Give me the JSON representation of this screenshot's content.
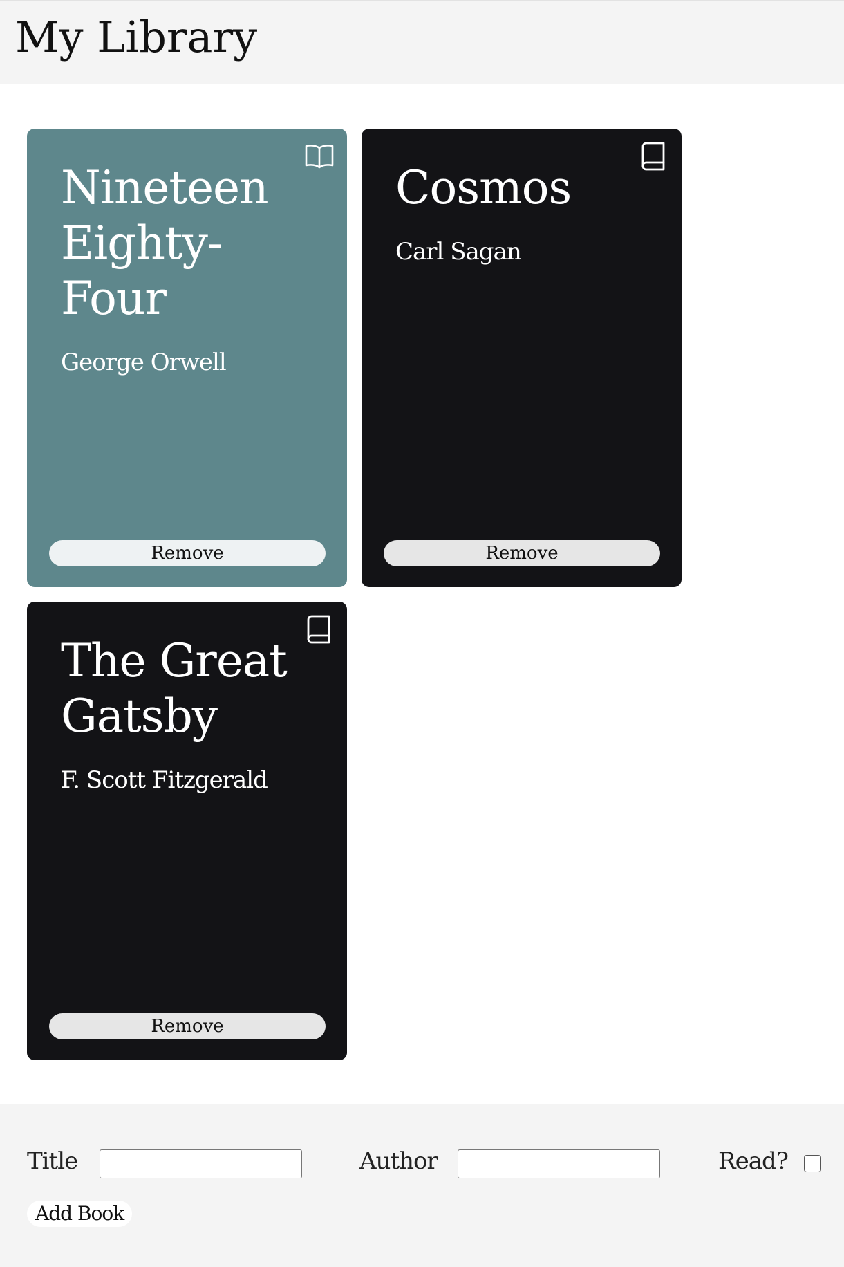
{
  "header": {
    "title": "My Library"
  },
  "books": [
    {
      "title": "Nineteen Eighty-Four",
      "title_lines": [
        "Nineteen",
        "Eighty-",
        "Four"
      ],
      "author": "George Orwell",
      "read": true,
      "status_icon": "open-book-icon",
      "remove_label": "Remove"
    },
    {
      "title": "Cosmos",
      "title_lines": [
        "Cosmos"
      ],
      "author": "Carl Sagan",
      "read": false,
      "status_icon": "closed-book-icon",
      "remove_label": "Remove"
    },
    {
      "title": "The Great Gatsby",
      "title_lines": [
        "The Great",
        "Gatsby"
      ],
      "author": "F. Scott Fitzgerald",
      "read": false,
      "status_icon": "closed-book-icon",
      "remove_label": "Remove"
    }
  ],
  "form": {
    "title_label": "Title",
    "title_value": "",
    "author_label": "Author",
    "author_value": "",
    "read_label": "Read?",
    "read_checked": false,
    "add_button_label": "Add Book"
  },
  "colors": {
    "read_card": "#5e878c",
    "unread_card": "#131316",
    "header_bg": "#f4f4f4"
  }
}
